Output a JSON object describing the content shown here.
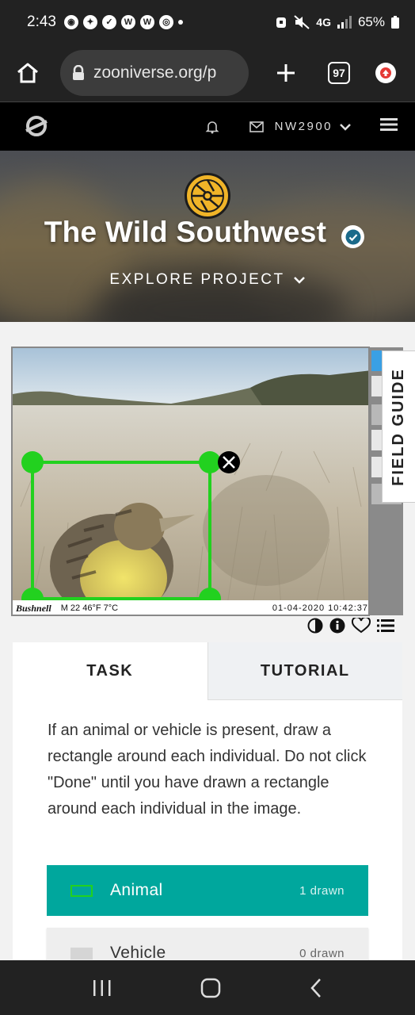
{
  "status": {
    "time": "2:43",
    "network": "4G",
    "battery": "65%"
  },
  "browser": {
    "url": "zooniverse.org/p",
    "tab_count": "97"
  },
  "nav": {
    "username": "NW2900"
  },
  "hero": {
    "title": "The Wild Southwest",
    "explore_label": "EXPLORE PROJECT"
  },
  "subject": {
    "watermark_brand": "Bushnell",
    "camera_info": "M  22  46°F 7°C",
    "timestamp": "01-04-2020  10:42:37"
  },
  "field_guide_label": "FIELD GUIDE",
  "tabs": [
    {
      "label": "TASK"
    },
    {
      "label": "TUTORIAL"
    }
  ],
  "task": {
    "instructions": "If an animal or vehicle is present, draw a rectangle around each individual. Do not click \"Done\" until you have drawn a rectangle around each individual in the image.",
    "choices": [
      {
        "label": "Animal",
        "count": "1 drawn",
        "color": "#00a79d"
      },
      {
        "label": "Vehicle",
        "count": "0 drawn",
        "color": "#eeeeee"
      }
    ]
  },
  "colors": {
    "accent": "#00a79d",
    "drawing": "#22d11f"
  }
}
